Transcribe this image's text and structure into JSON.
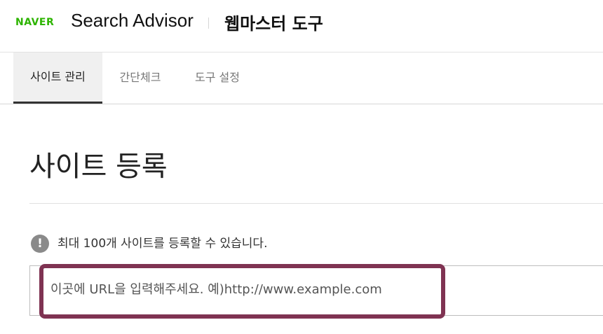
{
  "header": {
    "brand": "NAVER",
    "product": "Search Advisor",
    "subtitle": "웹마스터 도구"
  },
  "tabs": [
    {
      "label": "사이트 관리",
      "active": true
    },
    {
      "label": "간단체크",
      "active": false
    },
    {
      "label": "도구 설정",
      "active": false
    }
  ],
  "main": {
    "title": "사이트 등록",
    "notice_icon": "!",
    "notice": "최대 100개 사이트를 등록할 수 있습니다.",
    "url_placeholder": "이곳에 URL을 입력해주세요. 예)http://www.example.com"
  },
  "colors": {
    "brand": "#2db400",
    "highlight": "#7f3352",
    "active_tab_bg": "#f0f0f0"
  }
}
